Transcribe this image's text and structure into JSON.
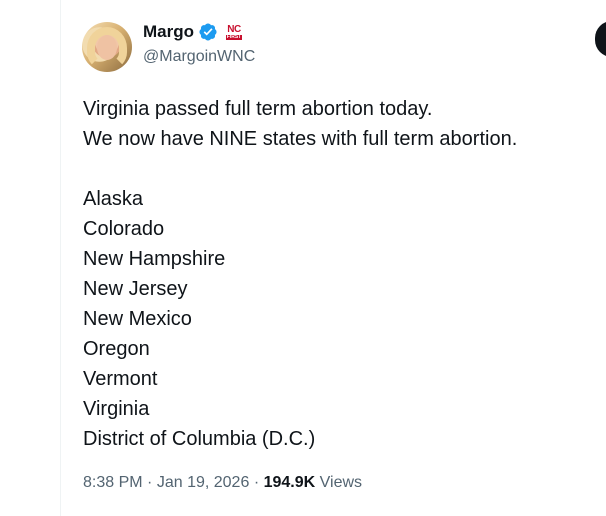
{
  "author": {
    "display_name": "Margo",
    "handle": "@MargoinWNC",
    "badge_text_top": "NC",
    "badge_text_bottom": "FIRST"
  },
  "tweet": {
    "lines": [
      "Virginia passed full term abortion today.",
      "We now have NINE states with full term abortion.",
      "",
      "Alaska",
      "Colorado",
      "New Hampshire",
      "New Jersey",
      "New Mexico",
      "Oregon",
      "Vermont",
      "Virginia",
      "District of Columbia (D.C.)"
    ]
  },
  "meta": {
    "time": "8:38 PM",
    "separator": "·",
    "date": "Jan 19, 2026",
    "views_count": "194.9K",
    "views_label": "Views"
  },
  "colors": {
    "verified": "#1d9bf0",
    "text": "#0f1419",
    "secondary": "#536471",
    "badge_red": "#c8102e"
  },
  "icons": [
    "verified-badge-icon",
    "nc-first-badge-icon",
    "more-options-icon"
  ]
}
